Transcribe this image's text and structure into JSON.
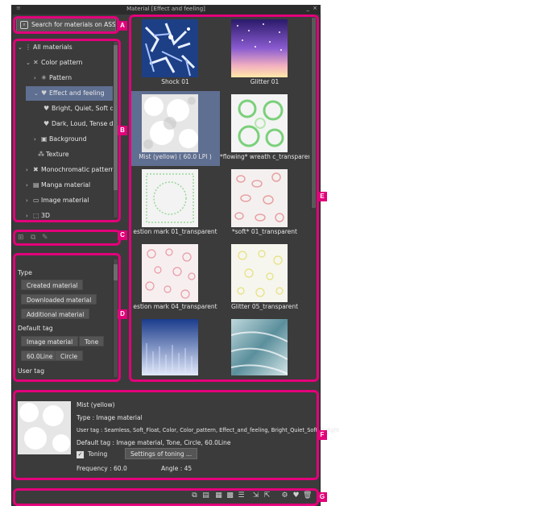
{
  "window": {
    "title": "Material [Effect and feeling]",
    "minimize_glyph": "_",
    "close_glyph": "×"
  },
  "search": {
    "label": "Search for materials on ASSETS",
    "icon": "search-icon"
  },
  "tree": {
    "items": [
      {
        "label": "All materials",
        "chevron": "⌄",
        "icon": "grid-icon"
      },
      {
        "label": "Color pattern",
        "chevron": "⌄",
        "icon": "pattern-icon"
      },
      {
        "label": "Pattern",
        "chevron": "›",
        "icon": "pattern-icon"
      },
      {
        "label": "Effect and feeling",
        "chevron": "⌄",
        "icon": "heart-icon"
      },
      {
        "label": "Bright, Quiet, Soft d",
        "chevron": "",
        "icon": "heart-icon"
      },
      {
        "label": "Dark, Loud, Tense d",
        "chevron": "",
        "icon": "heart-icon"
      },
      {
        "label": "Background",
        "chevron": "›",
        "icon": "image-icon"
      },
      {
        "label": "Texture",
        "chevron": "",
        "icon": "texture-icon"
      },
      {
        "label": "Monochromatic pattern",
        "chevron": "›",
        "icon": "mono-icon"
      },
      {
        "label": "Manga material",
        "chevron": "›",
        "icon": "manga-icon"
      },
      {
        "label": "Image material",
        "chevron": "›",
        "icon": "image-icon"
      },
      {
        "label": "3D",
        "chevron": "›",
        "icon": "cube-icon"
      }
    ]
  },
  "tags": {
    "type_heading": "Type",
    "type_tags": [
      "Created material",
      "Downloaded material",
      "Additional material"
    ],
    "default_heading": "Default tag",
    "default_tags": [
      "Image material",
      "Tone",
      "60.0Line",
      "Circle"
    ],
    "user_heading": "User tag"
  },
  "grid": {
    "items": [
      {
        "caption": "Shock 01"
      },
      {
        "caption": "Glitter 01"
      },
      {
        "caption": "Mist (yellow) ( 60.0 LPI )"
      },
      {
        "caption": "*flowing* wreath c_transparent_IS"
      },
      {
        "caption": "estion mark 01_transparent"
      },
      {
        "caption": "*soft* 01_transparent"
      },
      {
        "caption": "estion mark 04_transparent"
      },
      {
        "caption": "Glitter 05_transparent"
      }
    ]
  },
  "detail": {
    "name": "Mist (yellow)",
    "type": "Type : Image material",
    "user_tag": "User tag : Seamless, Soft_Float, Color, Color_pattern, Effect_and_feeling, Bright_Quiet_Soft_Delight",
    "default_tag": "Default tag : Image material, Tone, Circle, 60.0Line",
    "toning_label": "Toning",
    "toning_checked": true,
    "settings_button": "Settings of toning ...",
    "frequency": "Frequency : 60.0",
    "angle": "Angle : 45"
  },
  "callouts": [
    "A",
    "B",
    "C",
    "D",
    "E",
    "F",
    "G"
  ],
  "colors": {
    "accent": "#e2007a",
    "panel": "#3b3b3b",
    "selection": "#5f6f91"
  }
}
